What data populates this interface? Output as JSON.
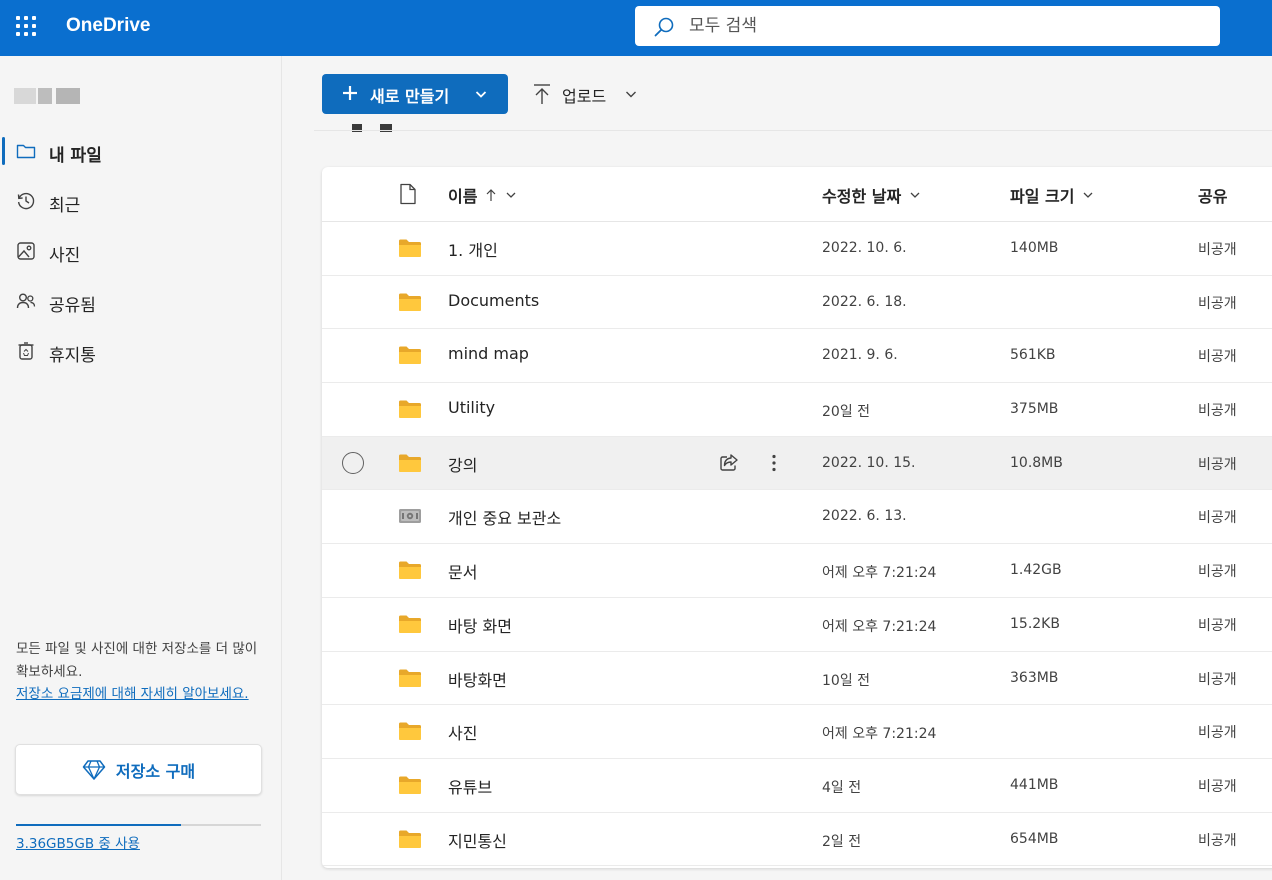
{
  "header": {
    "app_name": "OneDrive",
    "search_placeholder": "모두 검색"
  },
  "sidebar": {
    "items": [
      {
        "label": "내 파일",
        "icon": "folder-icon",
        "active": true
      },
      {
        "label": "최근",
        "icon": "history-icon",
        "active": false
      },
      {
        "label": "사진",
        "icon": "image-icon",
        "active": false
      },
      {
        "label": "공유됨",
        "icon": "people-icon",
        "active": false
      },
      {
        "label": "휴지통",
        "icon": "recycle-bin-icon",
        "active": false
      }
    ],
    "promo_text": "모든 파일 및 사진에 대한 저장소를 더 많이 확보하세요.",
    "promo_link": "저장소 요금제에 대해 자세히 알아보세요.",
    "buy_button": "저장소 구매",
    "quota_text": "3.36GB5GB 중 사용",
    "quota_used_fraction": 0.672
  },
  "toolbar": {
    "new_label": "새로 만들기",
    "upload_label": "업로드"
  },
  "list": {
    "columns": {
      "name": "이름",
      "modified": "수정한 날짜",
      "size": "파일 크기",
      "sharing": "공유"
    },
    "rows": [
      {
        "name": "1. 개인",
        "modified": "2022. 10. 6.",
        "size": "140MB",
        "sharing": "비공개",
        "type": "folder"
      },
      {
        "name": "Documents",
        "modified": "2022. 6. 18.",
        "size": "",
        "sharing": "비공개",
        "type": "folder"
      },
      {
        "name": "mind map",
        "modified": "2021. 9. 6.",
        "size": "561KB",
        "sharing": "비공개",
        "type": "folder"
      },
      {
        "name": "Utility",
        "modified": "20일 전",
        "size": "375MB",
        "sharing": "비공개",
        "type": "folder"
      },
      {
        "name": "강의",
        "modified": "2022. 10. 15.",
        "size": "10.8MB",
        "sharing": "비공개",
        "type": "folder",
        "hover": true
      },
      {
        "name": "개인 중요 보관소",
        "modified": "2022. 6. 13.",
        "size": "",
        "sharing": "비공개",
        "type": "vault"
      },
      {
        "name": "문서",
        "modified": "어제 오후 7:21:24",
        "size": "1.42GB",
        "sharing": "비공개",
        "type": "folder"
      },
      {
        "name": "바탕 화면",
        "modified": "어제 오후 7:21:24",
        "size": "15.2KB",
        "sharing": "비공개",
        "type": "folder"
      },
      {
        "name": "바탕화면",
        "modified": "10일 전",
        "size": "363MB",
        "sharing": "비공개",
        "type": "folder"
      },
      {
        "name": "사진",
        "modified": "어제 오후 7:21:24",
        "size": "",
        "sharing": "비공개",
        "type": "folder"
      },
      {
        "name": "유튜브",
        "modified": "4일 전",
        "size": "441MB",
        "sharing": "비공개",
        "type": "folder"
      },
      {
        "name": "지민통신",
        "modified": "2일 전",
        "size": "654MB",
        "sharing": "비공개",
        "type": "folder"
      }
    ]
  },
  "colors": {
    "brand": "#0a6fcf",
    "accent": "#0f6cbd",
    "folder": "#ffc83d"
  }
}
